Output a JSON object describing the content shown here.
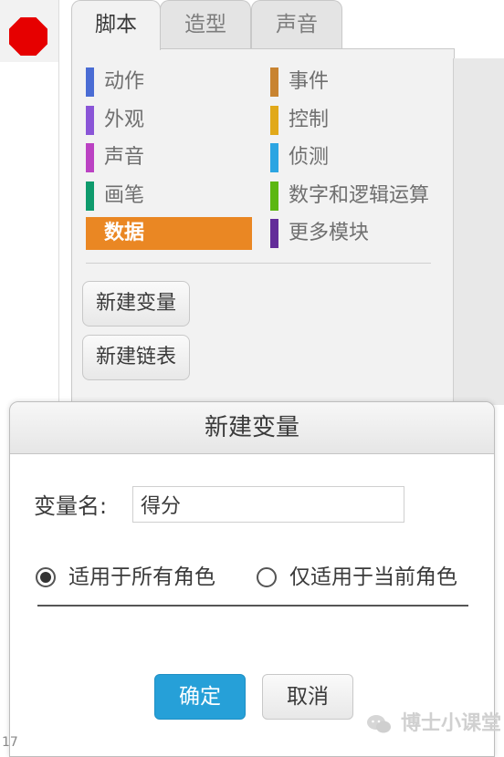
{
  "stop_button": {
    "icon": "stop-sign-icon",
    "color": "#e60000"
  },
  "tabs": [
    {
      "label": "脚本",
      "active": true
    },
    {
      "label": "造型",
      "active": false
    },
    {
      "label": "声音",
      "active": false
    }
  ],
  "categories_left": [
    {
      "label": "动作",
      "color": "#4a6cd4",
      "selected": false
    },
    {
      "label": "外观",
      "color": "#8a55d7",
      "selected": false
    },
    {
      "label": "声音",
      "color": "#bb42c3",
      "selected": false
    },
    {
      "label": "画笔",
      "color": "#0e9a6c",
      "selected": false
    },
    {
      "label": "数据",
      "color": "#ee7d16",
      "selected": true
    }
  ],
  "categories_right": [
    {
      "label": "事件",
      "color": "#c88330",
      "selected": false
    },
    {
      "label": "控制",
      "color": "#e1a91a",
      "selected": false
    },
    {
      "label": "侦测",
      "color": "#2ca5e2",
      "selected": false
    },
    {
      "label": "数字和逻辑运算",
      "color": "#5cb712",
      "selected": false
    },
    {
      "label": "更多模块",
      "color": "#632d99",
      "selected": false
    }
  ],
  "palette_buttons": {
    "new_variable": "新建变量",
    "new_list": "新建链表"
  },
  "dialog": {
    "title": "新建变量",
    "name_label": "变量名:",
    "name_value": "得分",
    "radio_all": "适用于所有角色",
    "radio_all_checked": true,
    "radio_current": "仅适用于当前角色",
    "radio_current_checked": false,
    "ok_label": "确定",
    "cancel_label": "取消",
    "ok_color": "#26a0d8"
  },
  "watermark": {
    "text": "博士小课堂",
    "icon": "wechat-icon"
  },
  "corner_text": "17"
}
